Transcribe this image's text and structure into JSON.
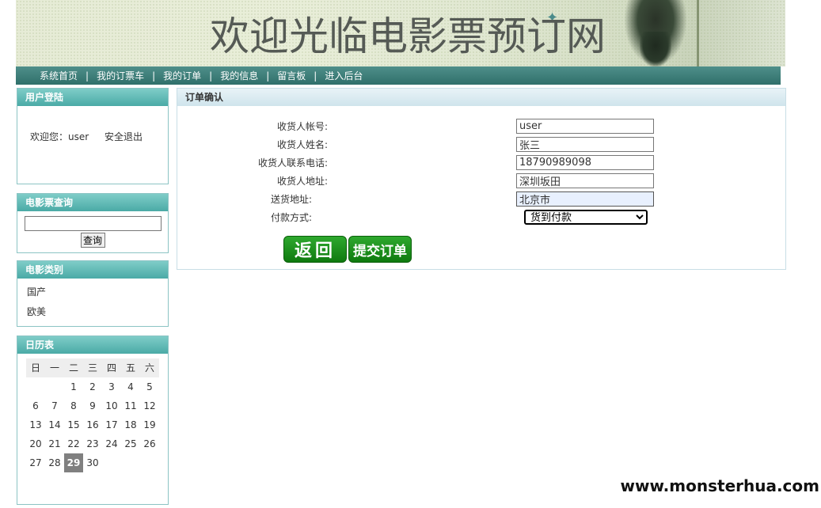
{
  "banner": {
    "title": "欢迎光临电影票预订网"
  },
  "nav": {
    "items": [
      "系统首页",
      "我的订票车",
      "我的订单",
      "我的信息",
      "留言板",
      "进入后台"
    ],
    "separator": "|"
  },
  "login_panel": {
    "title": "用户登陆",
    "welcome": "欢迎您：user",
    "logout": "安全退出"
  },
  "search_panel": {
    "title": "电影票查询",
    "input_value": "",
    "button": "查询"
  },
  "category_panel": {
    "title": "电影类别",
    "items": [
      "国产",
      "欧美"
    ]
  },
  "calendar_panel": {
    "title": "日历表",
    "weekdays": [
      "日",
      "一",
      "二",
      "三",
      "四",
      "五",
      "六"
    ],
    "days": [
      "",
      "",
      "1",
      "2",
      "3",
      "4",
      "5",
      "6",
      "7",
      "8",
      "9",
      "10",
      "11",
      "12",
      "13",
      "14",
      "15",
      "16",
      "17",
      "18",
      "19",
      "20",
      "21",
      "22",
      "23",
      "24",
      "25",
      "26",
      "27",
      "28",
      "29",
      "30",
      "",
      "",
      ""
    ],
    "today": "29"
  },
  "order": {
    "title": "订单确认",
    "fields": [
      {
        "label": "收货人帐号:",
        "value": "user"
      },
      {
        "label": "收货人姓名:",
        "value": "张三"
      },
      {
        "label": "收货人联系电话:",
        "value": "18790989098"
      },
      {
        "label": "收货人地址:",
        "value": "深圳坂田"
      },
      {
        "label": "送货地址:",
        "value": "北京市"
      }
    ],
    "payment_label": "付款方式:",
    "payment_value": "货到付款",
    "back_button": "返回",
    "submit_button": "提交订单"
  },
  "watermark": "www.monsterhua.com"
}
